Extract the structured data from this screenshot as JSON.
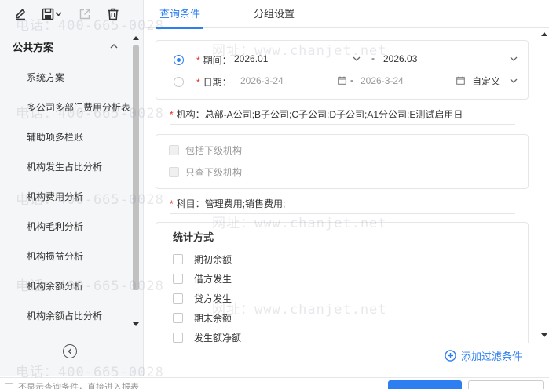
{
  "toolbar": {
    "icons": [
      "edit-icon",
      "save-icon",
      "export-icon",
      "delete-icon"
    ]
  },
  "sidebar": {
    "group_title": "公共方案",
    "items": [
      {
        "label": "系统方案"
      },
      {
        "label": "多公司多部门费用分析表"
      },
      {
        "label": "辅助项多栏账"
      },
      {
        "label": "机构发生占比分析"
      },
      {
        "label": "机构费用分析"
      },
      {
        "label": "机构毛利分析"
      },
      {
        "label": "机构损益分析"
      },
      {
        "label": "机构余额分析"
      },
      {
        "label": "机构余额占比分析"
      }
    ]
  },
  "tabs": [
    {
      "label": "查询条件",
      "active": true
    },
    {
      "label": "分组设置",
      "active": false
    }
  ],
  "period": {
    "label": "期间：",
    "selected": true,
    "from": "2026.01",
    "separator": "-",
    "to": "2026.03"
  },
  "date": {
    "label": "日期：",
    "selected": false,
    "from_placeholder": "2026-3-24",
    "separator": "-",
    "to_placeholder": "2026-3-24",
    "mode": "自定义"
  },
  "org": {
    "label": "机构：",
    "value": "总部-A公司;B子公司;C子公司;D子公司;A1分公司;E测试启用日",
    "include_sub_label": "包括下级机构",
    "only_sub_label": "只查下级机构"
  },
  "subject": {
    "label": "科目：",
    "value": "管理费用;销售费用;"
  },
  "stats": {
    "title": "统计方式",
    "options": [
      {
        "label": "期初余额",
        "checked": false
      },
      {
        "label": "借方发生",
        "checked": false
      },
      {
        "label": "贷方发生",
        "checked": false
      },
      {
        "label": "期末余额",
        "checked": false
      },
      {
        "label": "发生额净额",
        "checked": false
      }
    ]
  },
  "add_filter_label": "添加过滤条件",
  "bottom": {
    "option_label": "不显示查询条件，直接进入报表"
  },
  "watermark": {
    "phone": "电话：400-665-0028",
    "site": "网址：www.chanjet.net"
  },
  "colors": {
    "accent": "#2d7ef0",
    "required": "#e0301e"
  }
}
